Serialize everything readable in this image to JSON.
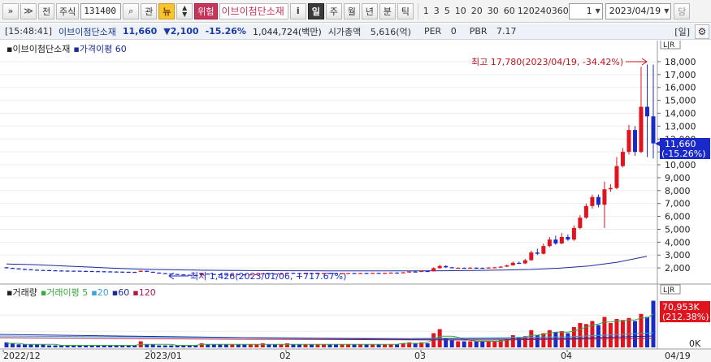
{
  "toolbar": {
    "expand_label": "»",
    "collapse_label": "≫",
    "jeon_label": "전",
    "type_label": "주식",
    "code_value": "131400",
    "search_label": "⌕",
    "gwan_label": "관",
    "news_label": "뉴",
    "warn_label": "위험",
    "stock_name": "이브이첨단소재",
    "info_label": "i",
    "periods": [
      {
        "label": "일",
        "active": true
      },
      {
        "label": "주",
        "active": false
      },
      {
        "label": "월",
        "active": false
      },
      {
        "label": "년",
        "active": false
      },
      {
        "label": "분",
        "active": false
      },
      {
        "label": "틱",
        "active": false
      }
    ],
    "intervals": [
      "1",
      "3",
      "5",
      "10",
      "20",
      "30",
      "60",
      "120",
      "240",
      "360"
    ],
    "count_value": "1",
    "date_value": "2023/04/19",
    "dang_label": "당"
  },
  "infobar": {
    "time": "[15:48:41]",
    "name": "이브이첨단소재",
    "price": "11,660",
    "change": "▼2,100",
    "change_pct": "-15.26%",
    "amount": "1,044,724(백만)",
    "mcap_label": "시가총액",
    "mcap_value": "5,616(억)",
    "per_label": "PER",
    "per_value": "0",
    "pbr_label": "PBR",
    "pbr_value": "7.17",
    "day_label": "[일]",
    "settings_icon": "gear-icon"
  },
  "colors": {
    "up": "#e0141e",
    "down": "#1a2ac8",
    "ma": "#1a2a9a",
    "vol_ma5": "#3aa83a",
    "vol_ma20": "#3aa0d8",
    "vol_ma60": "#1a2a9a",
    "vol_ma120": "#b01a4a"
  },
  "price_panel": {
    "legend_name": "이브이첨단소재",
    "legend_ma": "가격이평 60",
    "lr_label": "L|R",
    "high_note": "최고 17,780(2023/04/19, -34.42%)",
    "low_note": "최저 1,426(2023/01/06, +717.67%)",
    "current_label": "11,660",
    "current_pct": "(-15.26%)",
    "y_ticks": [
      "18,000",
      "17,000",
      "16,000",
      "15,000",
      "14,000",
      "13,000",
      "12,000",
      "11,000",
      "10,000",
      "9,000",
      "8,000",
      "7,000",
      "6,000",
      "5,000",
      "4,000",
      "3,000",
      "2,000"
    ]
  },
  "volume_panel": {
    "legend_name": "거래량",
    "legend_ma5": "거래이평 5",
    "legend_20": "20",
    "legend_60": "60",
    "legend_120": "120",
    "lr_label": "L|R",
    "current_label": "70,953K",
    "current_pct": "(212.38%)",
    "zero_label": "0K"
  },
  "x_axis": {
    "labels": [
      "2022/12",
      "2023/01",
      "02",
      "03",
      "04",
      "04/19"
    ]
  },
  "chart_data": {
    "type": "candlestick",
    "y_range": [
      1000,
      18500
    ],
    "y_ticks": [
      18000,
      17000,
      16000,
      15000,
      14000,
      13000,
      12000,
      11000,
      10000,
      9000,
      8000,
      7000,
      6000,
      5000,
      4000,
      3000,
      2000
    ],
    "high": 17780,
    "low": 1426,
    "current": 11660,
    "ma60": [
      2300,
      2250,
      2150,
      2050,
      1950,
      1880,
      1850,
      1820,
      1800,
      1790,
      1780,
      1775,
      1770,
      1770,
      1775,
      1780,
      1800,
      1830,
      1880,
      1980,
      2150,
      2450,
      2900
    ],
    "candles": [
      {
        "o": 2050,
        "c": 1990,
        "h": 2080,
        "l": 1960
      },
      {
        "o": 2000,
        "c": 1960,
        "h": 2020,
        "l": 1940
      },
      {
        "o": 1960,
        "c": 1920,
        "h": 1980,
        "l": 1900
      },
      {
        "o": 1920,
        "c": 1890,
        "h": 1940,
        "l": 1870
      },
      {
        "o": 1890,
        "c": 1860,
        "h": 1910,
        "l": 1840
      },
      {
        "o": 1860,
        "c": 1840,
        "h": 1880,
        "l": 1820
      },
      {
        "o": 1840,
        "c": 1820,
        "h": 1860,
        "l": 1800
      },
      {
        "o": 1830,
        "c": 1810,
        "h": 1850,
        "l": 1790
      },
      {
        "o": 1815,
        "c": 1800,
        "h": 1830,
        "l": 1780
      },
      {
        "o": 1800,
        "c": 1790,
        "h": 1820,
        "l": 1770
      },
      {
        "o": 1790,
        "c": 1780,
        "h": 1810,
        "l": 1760
      },
      {
        "o": 1785,
        "c": 1775,
        "h": 1800,
        "l": 1750
      },
      {
        "o": 1780,
        "c": 1770,
        "h": 1795,
        "l": 1740
      },
      {
        "o": 1770,
        "c": 1760,
        "h": 1790,
        "l": 1740
      },
      {
        "o": 1760,
        "c": 1750,
        "h": 1780,
        "l": 1730
      },
      {
        "o": 1750,
        "c": 1740,
        "h": 1770,
        "l": 1720
      },
      {
        "o": 1740,
        "c": 1730,
        "h": 1760,
        "l": 1710
      },
      {
        "o": 1730,
        "c": 1720,
        "h": 1750,
        "l": 1700
      },
      {
        "o": 1720,
        "c": 1710,
        "h": 1740,
        "l": 1690
      },
      {
        "o": 1710,
        "c": 1700,
        "h": 1730,
        "l": 1680
      },
      {
        "o": 1700,
        "c": 1690,
        "h": 1720,
        "l": 1680
      },
      {
        "o": 1690,
        "c": 1680,
        "h": 1710,
        "l": 1670
      },
      {
        "o": 1700,
        "c": 1780,
        "h": 1820,
        "l": 1690
      },
      {
        "o": 1780,
        "c": 1700,
        "h": 1790,
        "l": 1680
      },
      {
        "o": 1700,
        "c": 1640,
        "h": 1710,
        "l": 1620
      },
      {
        "o": 1640,
        "c": 1600,
        "h": 1650,
        "l": 1580
      },
      {
        "o": 1600,
        "c": 1560,
        "h": 1610,
        "l": 1540
      },
      {
        "o": 1560,
        "c": 1530,
        "h": 1570,
        "l": 1510
      },
      {
        "o": 1530,
        "c": 1500,
        "h": 1540,
        "l": 1480
      },
      {
        "o": 1500,
        "c": 1470,
        "h": 1510,
        "l": 1450
      },
      {
        "o": 1470,
        "c": 1450,
        "h": 1480,
        "l": 1426
      },
      {
        "o": 1450,
        "c": 1440,
        "h": 1470,
        "l": 1430
      },
      {
        "o": 1440,
        "c": 1560,
        "h": 1590,
        "l": 1430
      },
      {
        "o": 1560,
        "c": 1530,
        "h": 1580,
        "l": 1510
      },
      {
        "o": 1530,
        "c": 1510,
        "h": 1550,
        "l": 1490
      },
      {
        "o": 1510,
        "c": 1500,
        "h": 1530,
        "l": 1480
      },
      {
        "o": 1500,
        "c": 1490,
        "h": 1520,
        "l": 1470
      },
      {
        "o": 1490,
        "c": 1510,
        "h": 1530,
        "l": 1470
      },
      {
        "o": 1510,
        "c": 1500,
        "h": 1530,
        "l": 1480
      },
      {
        "o": 1500,
        "c": 1490,
        "h": 1520,
        "l": 1470
      },
      {
        "o": 1490,
        "c": 1500,
        "h": 1520,
        "l": 1470
      },
      {
        "o": 1500,
        "c": 1520,
        "h": 1540,
        "l": 1480
      },
      {
        "o": 1520,
        "c": 1580,
        "h": 1600,
        "l": 1500
      },
      {
        "o": 1580,
        "c": 1560,
        "h": 1620,
        "l": 1540
      },
      {
        "o": 1560,
        "c": 1540,
        "h": 1580,
        "l": 1520
      },
      {
        "o": 1540,
        "c": 1560,
        "h": 1590,
        "l": 1520
      },
      {
        "o": 1560,
        "c": 1620,
        "h": 1650,
        "l": 1540
      },
      {
        "o": 1620,
        "c": 1600,
        "h": 1640,
        "l": 1580
      },
      {
        "o": 1600,
        "c": 1590,
        "h": 1620,
        "l": 1570
      },
      {
        "o": 1590,
        "c": 1600,
        "h": 1620,
        "l": 1570
      },
      {
        "o": 1600,
        "c": 1590,
        "h": 1620,
        "l": 1570
      },
      {
        "o": 1590,
        "c": 1600,
        "h": 1620,
        "l": 1570
      },
      {
        "o": 1600,
        "c": 1610,
        "h": 1630,
        "l": 1580
      },
      {
        "o": 1610,
        "c": 1600,
        "h": 1630,
        "l": 1580
      },
      {
        "o": 1600,
        "c": 1590,
        "h": 1620,
        "l": 1570
      },
      {
        "o": 1590,
        "c": 1600,
        "h": 1620,
        "l": 1570
      },
      {
        "o": 1600,
        "c": 1610,
        "h": 1630,
        "l": 1580
      },
      {
        "o": 1610,
        "c": 1600,
        "h": 1630,
        "l": 1580
      },
      {
        "o": 1600,
        "c": 1610,
        "h": 1630,
        "l": 1580
      },
      {
        "o": 1610,
        "c": 1600,
        "h": 1630,
        "l": 1580
      },
      {
        "o": 1600,
        "c": 1620,
        "h": 1640,
        "l": 1580
      },
      {
        "o": 1620,
        "c": 1600,
        "h": 1640,
        "l": 1580
      },
      {
        "o": 1600,
        "c": 1620,
        "h": 1640,
        "l": 1580
      },
      {
        "o": 1620,
        "c": 1640,
        "h": 1660,
        "l": 1600
      },
      {
        "o": 1640,
        "c": 1620,
        "h": 1660,
        "l": 1600
      },
      {
        "o": 1620,
        "c": 1660,
        "h": 1690,
        "l": 1600
      },
      {
        "o": 1660,
        "c": 1720,
        "h": 1760,
        "l": 1640
      },
      {
        "o": 1720,
        "c": 1700,
        "h": 1760,
        "l": 1680
      },
      {
        "o": 1700,
        "c": 1760,
        "h": 1800,
        "l": 1680
      },
      {
        "o": 1760,
        "c": 1740,
        "h": 1800,
        "l": 1720
      },
      {
        "o": 1740,
        "c": 1980,
        "h": 2050,
        "l": 1720
      },
      {
        "o": 1980,
        "c": 2150,
        "h": 2250,
        "l": 1950
      },
      {
        "o": 2150,
        "c": 2050,
        "h": 2200,
        "l": 2000
      },
      {
        "o": 2050,
        "c": 2000,
        "h": 2080,
        "l": 1980
      },
      {
        "o": 2000,
        "c": 2010,
        "h": 2060,
        "l": 1980
      },
      {
        "o": 2010,
        "c": 2000,
        "h": 2040,
        "l": 1980
      },
      {
        "o": 2000,
        "c": 2020,
        "h": 2060,
        "l": 1980
      },
      {
        "o": 2020,
        "c": 2010,
        "h": 2050,
        "l": 1990
      },
      {
        "o": 2010,
        "c": 2000,
        "h": 2040,
        "l": 1980
      },
      {
        "o": 2000,
        "c": 2030,
        "h": 2060,
        "l": 1980
      },
      {
        "o": 2030,
        "c": 2050,
        "h": 2080,
        "l": 2000
      },
      {
        "o": 2050,
        "c": 2100,
        "h": 2150,
        "l": 2020
      },
      {
        "o": 2100,
        "c": 2200,
        "h": 2260,
        "l": 2080
      },
      {
        "o": 2200,
        "c": 2400,
        "h": 2500,
        "l": 2180
      },
      {
        "o": 2400,
        "c": 2350,
        "h": 2500,
        "l": 2300
      },
      {
        "o": 2350,
        "c": 2600,
        "h": 2700,
        "l": 2300
      },
      {
        "o": 2600,
        "c": 3200,
        "h": 3350,
        "l": 2550
      },
      {
        "o": 3200,
        "c": 3100,
        "h": 3500,
        "l": 3000
      },
      {
        "o": 3100,
        "c": 3700,
        "h": 3900,
        "l": 3050
      },
      {
        "o": 3700,
        "c": 4200,
        "h": 4400,
        "l": 3600
      },
      {
        "o": 4200,
        "c": 3900,
        "h": 4500,
        "l": 3800
      },
      {
        "o": 3900,
        "c": 4400,
        "h": 4700,
        "l": 3850
      },
      {
        "o": 4400,
        "c": 4200,
        "h": 4600,
        "l": 4100
      },
      {
        "o": 4200,
        "c": 5100,
        "h": 5300,
        "l": 4100
      },
      {
        "o": 5100,
        "c": 5900,
        "h": 6100,
        "l": 5000
      },
      {
        "o": 5900,
        "c": 6800,
        "h": 7000,
        "l": 5800
      },
      {
        "o": 6800,
        "c": 7500,
        "h": 7700,
        "l": 6600
      },
      {
        "o": 7500,
        "c": 6900,
        "h": 7700,
        "l": 6700
      },
      {
        "o": 6900,
        "c": 8100,
        "h": 8700,
        "l": 5100
      },
      {
        "o": 8100,
        "c": 8200,
        "h": 8500,
        "l": 7900
      },
      {
        "o": 8200,
        "c": 9900,
        "h": 10600,
        "l": 8100
      },
      {
        "o": 9900,
        "c": 11000,
        "h": 11300,
        "l": 9800
      },
      {
        "o": 11000,
        "c": 12700,
        "h": 13100,
        "l": 10800
      },
      {
        "o": 12700,
        "c": 11000,
        "h": 13000,
        "l": 10700
      },
      {
        "o": 11000,
        "c": 14500,
        "h": 17600,
        "l": 10900
      },
      {
        "o": 14500,
        "c": 13760,
        "h": 17780,
        "l": 10600
      },
      {
        "o": 13760,
        "c": 11660,
        "h": 17780,
        "l": 10500
      }
    ],
    "volume_series": [
      {
        "name": "거래량",
        "values": [
          5,
          4,
          3,
          3,
          3,
          3,
          3,
          2,
          2,
          2,
          2,
          2,
          2,
          2,
          2,
          2,
          2,
          2,
          2,
          2,
          2,
          2,
          6,
          3,
          3,
          2,
          2,
          2,
          2,
          2,
          2,
          2,
          4,
          3,
          3,
          3,
          3,
          3,
          3,
          3,
          3,
          3,
          4,
          3,
          3,
          3,
          4,
          3,
          3,
          3,
          3,
          3,
          3,
          3,
          3,
          3,
          3,
          3,
          3,
          3,
          3,
          3,
          3,
          3,
          3,
          4,
          5,
          4,
          5,
          4,
          14,
          18,
          9,
          7,
          6,
          6,
          6,
          6,
          6,
          6,
          6,
          7,
          8,
          12,
          10,
          11,
          17,
          12,
          14,
          17,
          15,
          16,
          14,
          20,
          24,
          23,
          26,
          22,
          30,
          24,
          28,
          27,
          29,
          26,
          33,
          30,
          46
        ]
      },
      {
        "name": "거래이평 5",
        "values": [
          4,
          4,
          4,
          3,
          3,
          3,
          3,
          3,
          3,
          2,
          2,
          2,
          2,
          2,
          2,
          2,
          2,
          2,
          2,
          2,
          2,
          2,
          3,
          3,
          3,
          3,
          3,
          3,
          2,
          2,
          2,
          2,
          3,
          3,
          3,
          3,
          3,
          3,
          3,
          3,
          3,
          3,
          3,
          3,
          3,
          3,
          3,
          3,
          3,
          3,
          3,
          3,
          3,
          3,
          3,
          3,
          3,
          3,
          3,
          3,
          3,
          3,
          3,
          3,
          3,
          4,
          4,
          4,
          4,
          5,
          8,
          11,
          11,
          11,
          10,
          8,
          7,
          6,
          6,
          6,
          6,
          6,
          7,
          8,
          9,
          10,
          12,
          12,
          13,
          14,
          15,
          15,
          15,
          16,
          18,
          20,
          22,
          23,
          25,
          25,
          26,
          26,
          27,
          27,
          29,
          29,
          33
        ]
      }
    ]
  }
}
